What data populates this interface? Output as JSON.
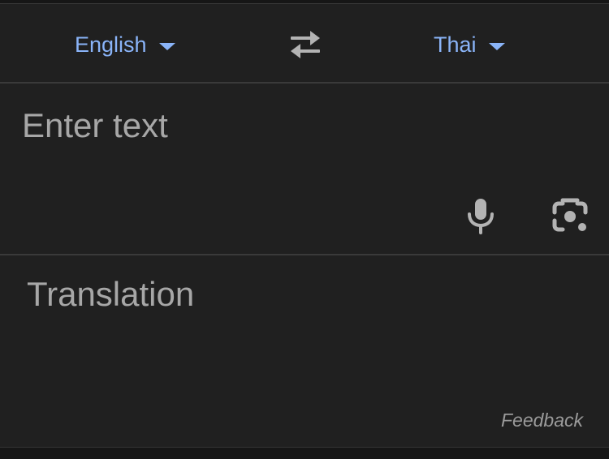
{
  "languages": {
    "source": "English",
    "target": "Thai",
    "accent_color": "#8ab4f8"
  },
  "icons": {
    "swap": "swap-arrows-icon",
    "source_caret": "caret-down-icon",
    "target_caret": "caret-down-icon",
    "mic": "microphone-icon",
    "camera": "camera-lens-icon"
  },
  "input": {
    "placeholder": "Enter text"
  },
  "output": {
    "placeholder": "Translation"
  },
  "footer": {
    "feedback_label": "Feedback"
  },
  "theme": {
    "background": "#202020",
    "divider": "#3a3a3a",
    "icon_color": "#b3b3b3"
  }
}
